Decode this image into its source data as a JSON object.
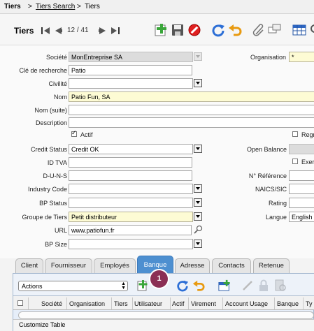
{
  "breadcrumb": {
    "root": "Tiers",
    "sep1": ">",
    "search": "Tiers Search",
    "sep2": ">",
    "current": "Tiers"
  },
  "header": {
    "title": "Tiers",
    "record_counter": "12 / 41"
  },
  "form": {
    "societe": {
      "label": "Société",
      "value": "MonEntreprise SA"
    },
    "organisation": {
      "label": "Organisation",
      "value": "*"
    },
    "cle": {
      "label": "Clé de recherche",
      "value": "Patio"
    },
    "civilite": {
      "label": "Civilité",
      "value": ""
    },
    "nom": {
      "label": "Nom",
      "value": "Patio Fun, SA"
    },
    "nom_suite": {
      "label": "Nom (suite)",
      "value": ""
    },
    "description": {
      "label": "Description",
      "value": ""
    },
    "actif": {
      "label": "Actif",
      "checked": true
    },
    "regr": {
      "label": "Regr",
      "checked": false
    },
    "credit_status": {
      "label": "Credit Status",
      "value": "Credit OK"
    },
    "open_balance": {
      "label": "Open Balance",
      "value": ""
    },
    "id_tva": {
      "label": "ID TVA",
      "value": ""
    },
    "exer": {
      "label": "Exer",
      "checked": false
    },
    "duns": {
      "label": "D-U-N-S",
      "value": ""
    },
    "reference": {
      "label": "N° Référence",
      "value": ""
    },
    "industry": {
      "label": "Industry Code",
      "value": ""
    },
    "naics": {
      "label": "NAICS/SIC",
      "value": ""
    },
    "bp_status": {
      "label": "BP Status",
      "value": ""
    },
    "rating": {
      "label": "Rating",
      "value": ""
    },
    "groupe": {
      "label": "Groupe de Tiers",
      "value": "Petit distributeur"
    },
    "langue": {
      "label": "Langue",
      "value": "English"
    },
    "url": {
      "label": "URL",
      "value": "www.patiofun.fr"
    },
    "bp_size": {
      "label": "BP Size",
      "value": ""
    }
  },
  "tabs": [
    {
      "label": "Client"
    },
    {
      "label": "Fournisseur"
    },
    {
      "label": "Employés"
    },
    {
      "label": "Banque"
    },
    {
      "label": "Adresse"
    },
    {
      "label": "Contacts"
    },
    {
      "label": "Retenue"
    }
  ],
  "subpanel": {
    "actions_label": "Actions",
    "badge": "1",
    "columns": [
      "Société",
      "Organisation",
      "Tiers",
      "Utilisateur",
      "Actif",
      "Virement",
      "Account Usage",
      "Banque",
      "Ty"
    ],
    "customize": "Customize Table"
  },
  "colors": {
    "active_tab": "#4d8fd0",
    "mandatory_bg": "#fdfbd4",
    "badge": "#8b2f55"
  },
  "icons": [
    "first-record-icon",
    "previous-record-icon",
    "next-record-icon",
    "last-record-icon",
    "new-icon",
    "save-icon",
    "delete-icon",
    "refresh-icon",
    "undo-icon",
    "attachment-icon",
    "chat-icon",
    "grid-toggle-icon",
    "search-icon",
    "zoom-icon"
  ]
}
